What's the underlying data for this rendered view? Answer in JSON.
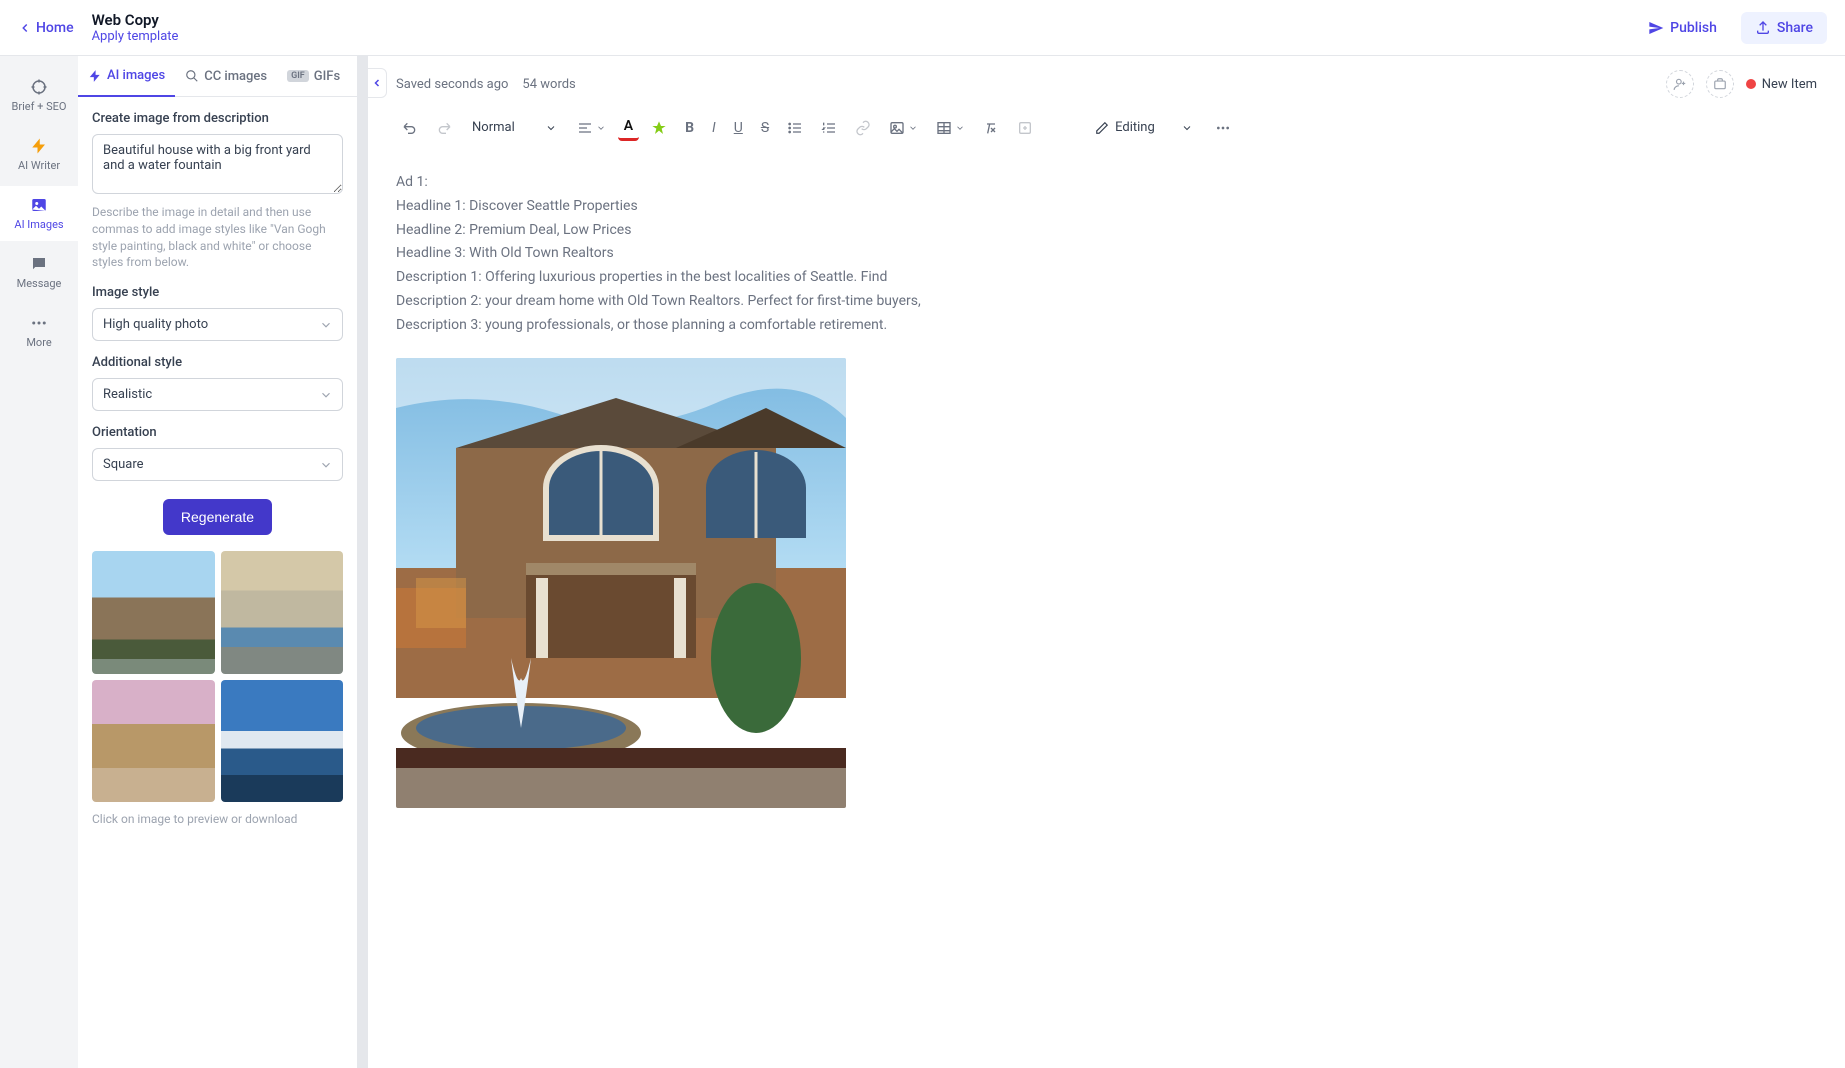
{
  "header": {
    "home": "Home",
    "title": "Web Copy",
    "apply_template": "Apply template",
    "publish": "Publish",
    "share": "Share"
  },
  "rail": {
    "items": [
      {
        "label": "Brief + SEO",
        "icon": "target-icon"
      },
      {
        "label": "AI Writer",
        "icon": "bolt-icon"
      },
      {
        "label": "AI Images",
        "icon": "image-icon"
      },
      {
        "label": "Message",
        "icon": "chat-icon"
      },
      {
        "label": "More",
        "icon": "dots-icon"
      }
    ],
    "active_index": 2
  },
  "panel": {
    "tabs": [
      {
        "label": "AI images",
        "icon": "bolt-icon"
      },
      {
        "label": "CC images",
        "icon": "search-icon"
      },
      {
        "label": "GIFs",
        "icon": "gif-badge"
      }
    ],
    "active_tab": 0,
    "description_label": "Create image from description",
    "description_value": "Beautiful house with a big front yard and a water fountain",
    "description_help": "Describe the image in detail and then use commas to add image styles like \"Van Gogh style painting, black and white\" or choose styles from below.",
    "image_style_label": "Image style",
    "image_style_value": "High quality photo",
    "additional_style_label": "Additional style",
    "additional_style_value": "Realistic",
    "orientation_label": "Orientation",
    "orientation_value": "Square",
    "regenerate": "Regenerate",
    "thumb_help": "Click on image to preview or download"
  },
  "editor": {
    "saved": "Saved seconds ago",
    "word_count": "54 words",
    "new_item": "New Item",
    "format": "Normal",
    "editing_label": "Editing",
    "content": {
      "lines": [
        "Ad 1:",
        "Headline 1: Discover Seattle Properties",
        "Headline 2: Premium Deal, Low Prices",
        "Headline 3: With Old Town Realtors",
        "Description 1: Offering luxurious properties in the best localities of Seattle. Find",
        "Description 2: your dream home with Old Town Realtors. Perfect for first-time buyers,",
        "Description 3: young professionals, or those planning a comfortable retirement."
      ]
    }
  },
  "colors": {
    "primary": "#4f46e5",
    "text": "#374151",
    "muted": "#9ca3af"
  }
}
